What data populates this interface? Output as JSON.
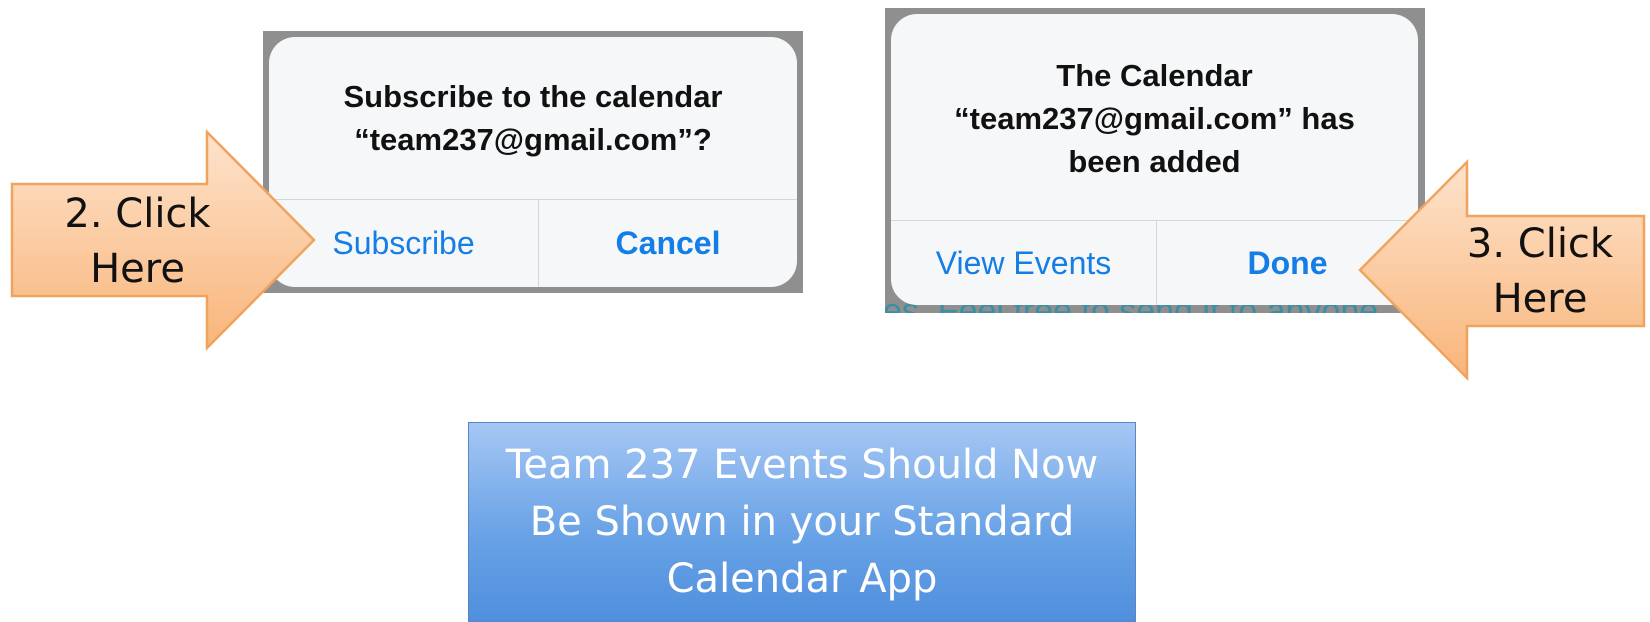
{
  "subscribe_dialog": {
    "title_lines": [
      "Subscribe to the calendar",
      "“team237@gmail.com”?"
    ],
    "subscribe_label": "Subscribe",
    "cancel_label": "Cancel"
  },
  "added_dialog": {
    "title_lines": [
      "The Calendar",
      "“team237@gmail.com” has",
      "been added"
    ],
    "view_events_label": "View Events",
    "done_label": "Done",
    "background_text": "es. Feel free to send it to anyone."
  },
  "callout_left": {
    "lines": [
      "2. Click",
      "Here"
    ]
  },
  "callout_right": {
    "lines": [
      "3. Click",
      "Here"
    ]
  },
  "result_box": {
    "lines": [
      "Team 237 Events Should Now",
      "Be Shown in your Standard",
      "Calendar App"
    ]
  },
  "colors": {
    "ios_blue": "#147ee6",
    "arrow_fill_light": "#fde3cc",
    "arrow_fill_dark": "#f9b57a",
    "arrow_border": "#f0a35e",
    "result_box_top": "#a6c7f4",
    "result_box_bottom": "#4f8fdd"
  }
}
